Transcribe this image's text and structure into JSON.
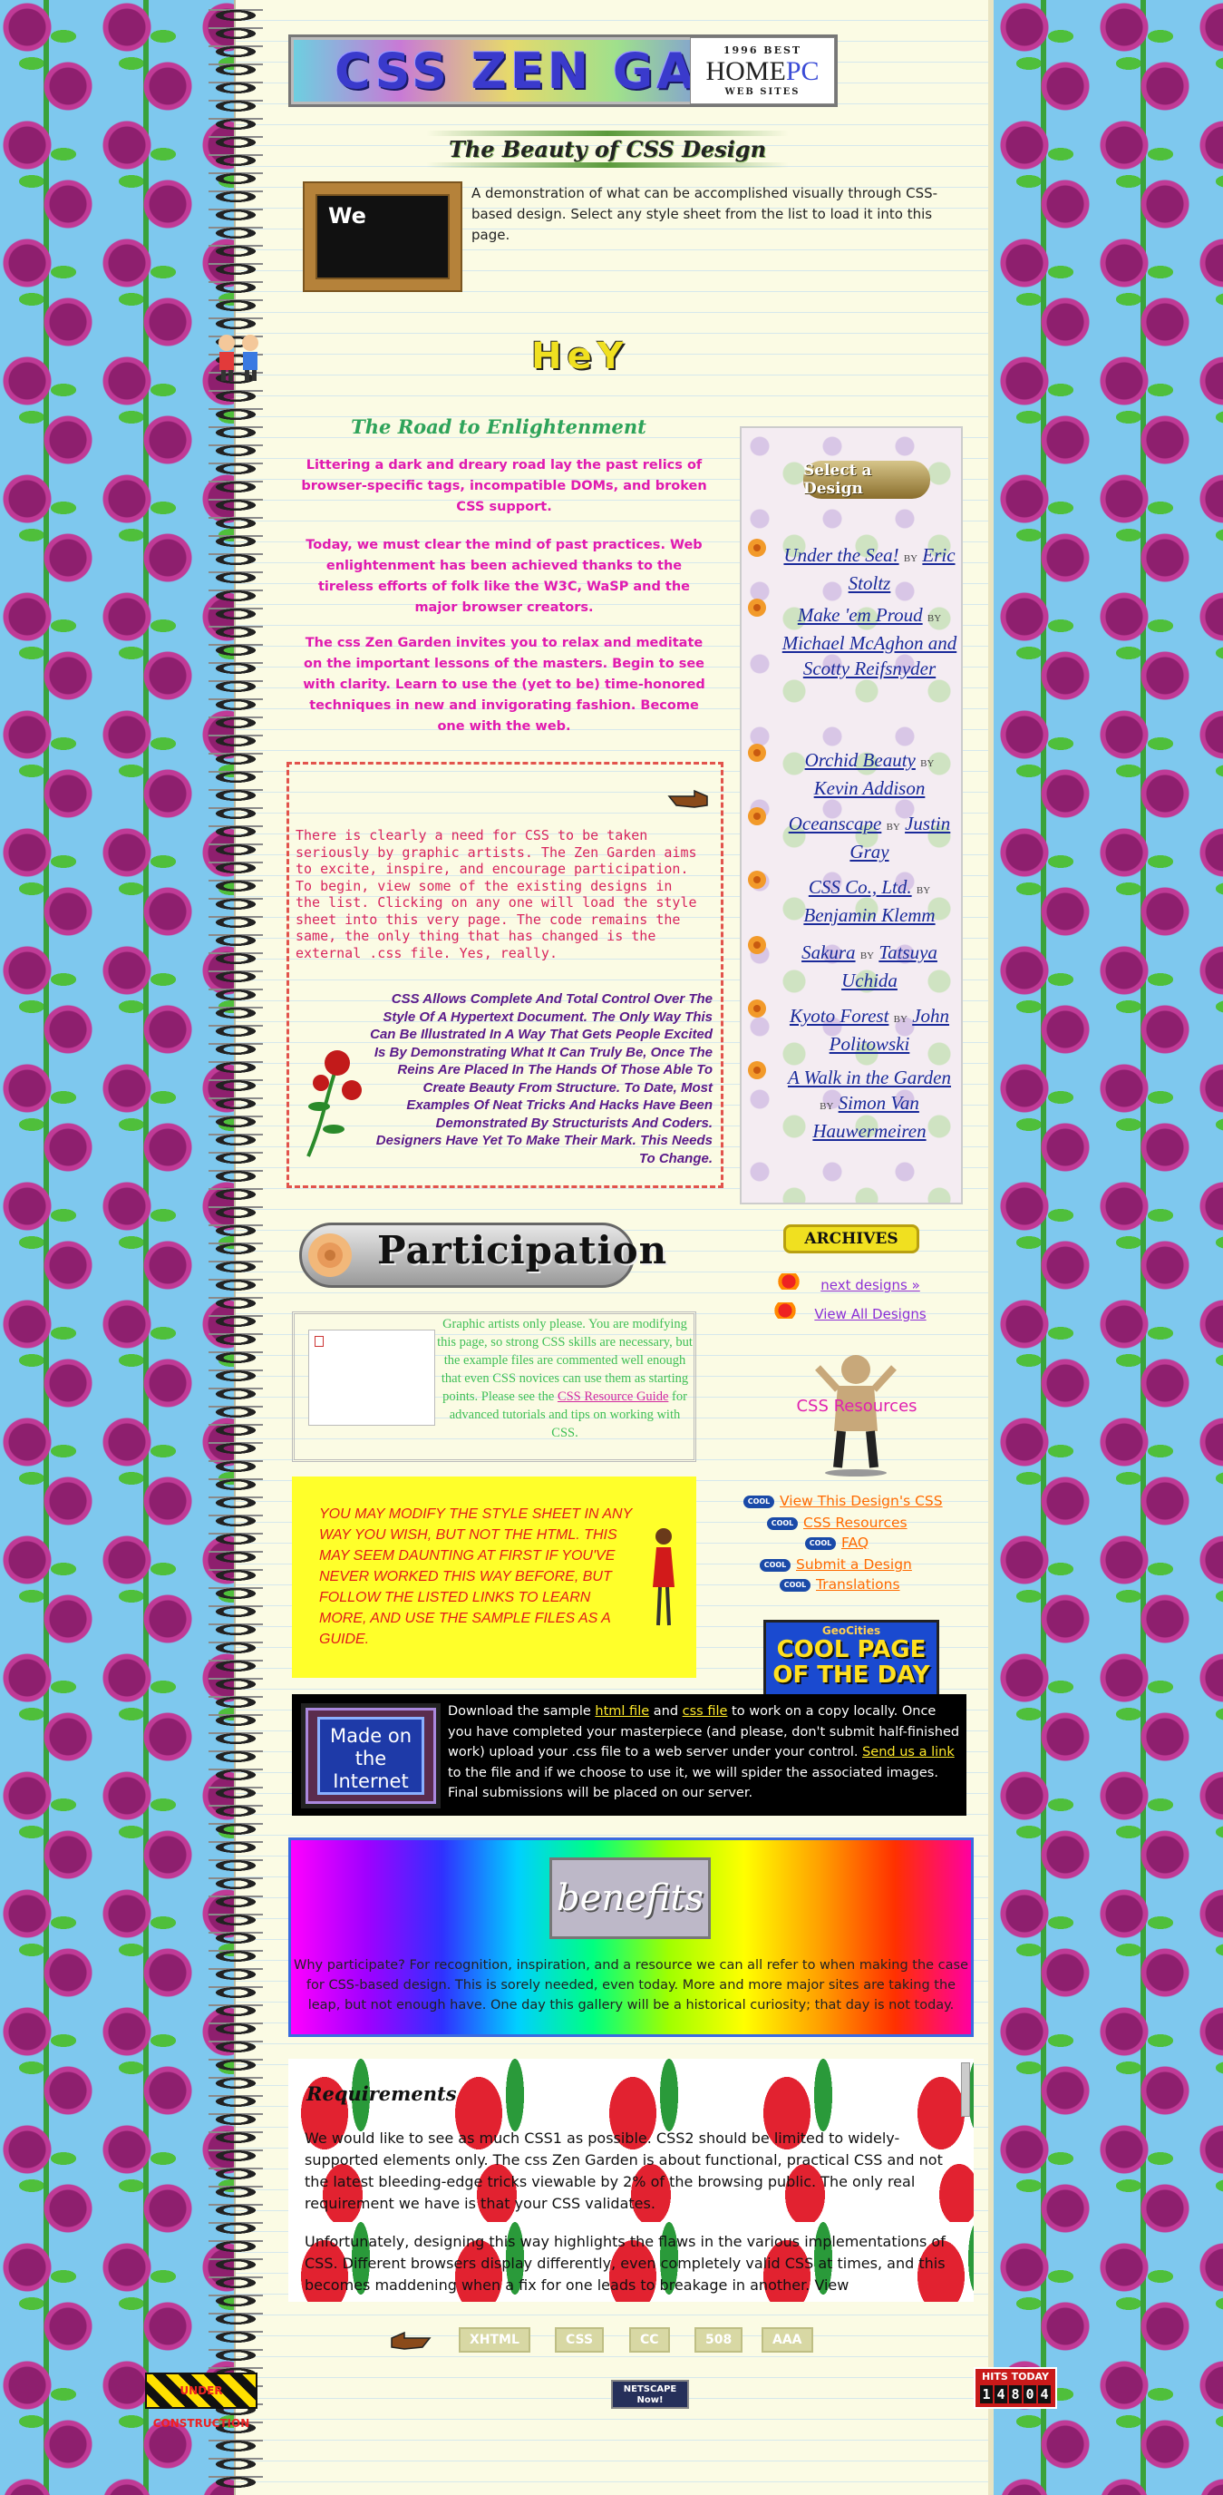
{
  "banner": {
    "title": "CSS ZEN GARDEN",
    "award": {
      "line1": "1996 BEST",
      "brand_a": "HOME",
      "brand_b": "PC",
      "line3": "WEB SITES"
    }
  },
  "tagline": "The Beauty of CSS Design",
  "chalkboard_text": "We",
  "intro": "A demonstration of what can be accomplished visually through CSS-based design. Select any style sheet from the list to load it into this page.",
  "hey_text": "HeY",
  "road": {
    "title": "The Road to Enlightenment",
    "p1": "Littering a dark and dreary road lay the past relics of browser-specific tags, incompatible DOMs, and broken CSS support.",
    "p2": "Today, we must clear the mind of past practices. Web enlightenment has been achieved thanks to the tireless efforts of folk like the W3C, WaSP and the major browser creators.",
    "p3": "The css Zen Garden invites you to relax and meditate on the important lessons of the masters. Begin to see with clarity. Learn to use the (yet to be) time-honored techniques in new and invigorating fashion. Become one with the web."
  },
  "explanation": {
    "mono": "There is clearly a need for CSS to be taken seriously by graphic artists. The Zen Garden aims to excite, inspire, and encourage participation. To begin, view some of the existing designs in the list. Clicking on any one will load the style sheet into this very page. The code remains the same, the only thing that has changed is the external .css file. Yes, really.",
    "italic": "CSS Allows Complete And Total Control Over The Style Of A Hypertext Document. The Only Way This Can Be Illustrated In A Way That Gets People Excited Is By Demonstrating What It Can Truly Be, Once The Reins Are Placed In The Hands Of Those Able To Create Beauty From Structure. To Date, Most Examples Of Neat Tricks And Hacks Have Been Demonstrated By Structurists And Coders. Designers Have Yet To Make Their Mark. This Needs To Change."
  },
  "select_design": {
    "heading": "Select a Design",
    "by": "by",
    "items": [
      {
        "title": "Under the Sea!",
        "author": "Eric Stoltz"
      },
      {
        "title": "Make 'em Proud",
        "author": "Michael McAghon and Scotty Reifsnyder"
      },
      {
        "title": "Orchid Beauty",
        "author": "Kevin Addison"
      },
      {
        "title": "Oceanscape",
        "author": "Justin Gray"
      },
      {
        "title": "CSS Co., Ltd.",
        "author": "Benjamin Klemm"
      },
      {
        "title": "Sakura",
        "author": "Tatsuya Uchida"
      },
      {
        "title": "Kyoto Forest",
        "author": "John Politowski"
      },
      {
        "title": "A Walk in the Garden",
        "author": "Simon Van Hauwermeiren"
      }
    ]
  },
  "archives": {
    "heading": "ARCHIVES",
    "next": "next designs »",
    "view_all": "View All Designs"
  },
  "participation": {
    "title": "Participation",
    "graphic_text_a": "Graphic artists only please. You are modifying this page, so strong CSS skills are necessary, but the example files are commented well enough that even CSS novices can use them as starting points. Please see the ",
    "graphic_link": "CSS Resource Guide",
    "graphic_text_b": " for advanced tutorials and tips on working with CSS.",
    "warning": "You may modify the style sheet in any way you wish, but not the HTML. This may seem daunting at first if you've never worked this way before, but follow the listed links to learn more, and use the sample files as a guide.",
    "made_on": "Made on the Internet",
    "download_a": "Download the sample ",
    "html_file": "html file",
    "and": " and ",
    "css_file": "css file",
    "download_b": " to work on a copy locally. Once you have completed your masterpiece (and please, don't submit half-finished work) upload your .css file to a web server under your control. ",
    "send_link": "Send us a link",
    "download_c": " to the file and if we choose to use it, we will spider the associated images. Final submissions will be placed on our server."
  },
  "resources": {
    "heading": "CSS Resources",
    "badge": "COOL",
    "links": [
      "View This Design's CSS",
      "CSS Resources",
      "FAQ",
      "Submit a Design",
      "Translations"
    ]
  },
  "geocities": {
    "line1": "GeoCities",
    "line2": "COOL PAGE OF THE DAY"
  },
  "benefits": {
    "title": "benefits",
    "text": "Why participate? For recognition, inspiration, and a resource we can all refer to when making the case for CSS-based design. This is sorely needed, even today. More and more major sites are taking the leap, but not enough have. One day this gallery will be a historical curiosity; that day is not today."
  },
  "requirements": {
    "title": "Requirements",
    "p1": "We would like to see as much CSS1 as possible. CSS2 should be limited to widely-supported elements only. The css Zen Garden is about functional, practical CSS and not the latest bleeding-edge tricks viewable by 2% of the browsing public. The only real requirement we have is that your CSS validates.",
    "p2": "Unfortunately, designing this way highlights the flaws in the various implementations of CSS. Different browsers display differently, even completely valid CSS at times, and this becomes maddening when a fix for one leads to breakage in another. View"
  },
  "footer": {
    "links": [
      "XHTML",
      "CSS",
      "CC",
      "508",
      "AAA"
    ],
    "construction": "UNDER CONSTRUCTION",
    "netscape": "NETSCAPE Now!",
    "hits_label": "HITS TODAY",
    "hits_digits": [
      "1",
      "4",
      "8",
      "0",
      "4"
    ]
  }
}
